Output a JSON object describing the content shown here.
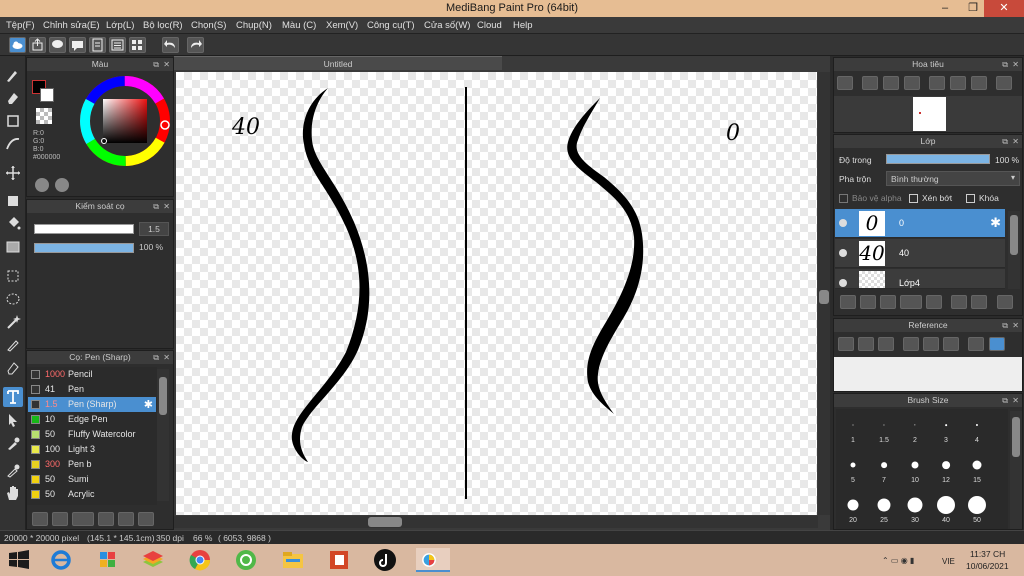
{
  "window": {
    "title": "MediBang Paint Pro (64bit)",
    "minimize": "–",
    "maximize": "❐",
    "close": "✕"
  },
  "menu": [
    "Tệp(F)",
    "Chỉnh sửa(E)",
    "Lớp(L)",
    "Bộ lọc(R)",
    "Chọn(S)",
    "Chụp(N)",
    "Màu (C)",
    "Xem(V)",
    "Công cụ(T)",
    "Cửa số(W)",
    "Cloud",
    "Help"
  ],
  "color_panel": {
    "title": "Màu",
    "r": "R:0",
    "g": "G:0",
    "b": "B:0",
    "hex": "#000000"
  },
  "brush_control": {
    "title": "Kiểm soát cọ",
    "size": "1.5",
    "opacity": "100 %"
  },
  "brush_list": {
    "title": "Cọ: Pen (Sharp)",
    "items": [
      {
        "size": "1000",
        "name": "Pencil",
        "color": "#333333",
        "size_color": "#ff6a6a"
      },
      {
        "size": "41",
        "name": "Pen",
        "color": "#333333",
        "size_color": "#e6e6e6"
      },
      {
        "size": "1.5",
        "name": "Pen (Sharp)",
        "color": "#333333",
        "size_color": "#ff8a8a"
      },
      {
        "size": "10",
        "name": "Edge Pen",
        "color": "#18b818",
        "size_color": "#e6e6e6"
      },
      {
        "size": "50",
        "name": "Fluffy Watercolor",
        "color": "#b8e070",
        "size_color": "#e6e6e6"
      },
      {
        "size": "100",
        "name": "Light 3",
        "color": "#e8e84a",
        "size_color": "#e6e6e6"
      },
      {
        "size": "300",
        "name": "Pen b",
        "color": "#e8d020",
        "size_color": "#ff6a6a"
      },
      {
        "size": "50",
        "name": "Sumi",
        "color": "#f0d010",
        "size_color": "#e6e6e6"
      },
      {
        "size": "50",
        "name": "Acrylic",
        "color": "#f0d010",
        "size_color": "#e6e6e6"
      }
    ]
  },
  "canvas": {
    "tab": "Untitled",
    "label_left": "40",
    "label_right": "0"
  },
  "navigator": {
    "title": "Hoa tiêu"
  },
  "layers": {
    "title": "Lớp",
    "opacity_label": "Độ trong",
    "opacity_value": "100 %",
    "blend_label": "Pha trộn",
    "blend_value": "Bình thường",
    "protect_alpha": "Bảo vệ alpha",
    "clipping": "Xén bớt",
    "lock": "Khóa",
    "items": [
      {
        "name": "0",
        "thumb": "0",
        "selected": true
      },
      {
        "name": "40",
        "thumb": "40",
        "selected": false
      },
      {
        "name": "Lớp4",
        "thumb": "",
        "selected": false
      }
    ]
  },
  "reference": {
    "title": "Reference"
  },
  "brush_size": {
    "title": "Brush Size",
    "sizes": [
      "1",
      "1.5",
      "2",
      "3",
      "4",
      "5",
      "7",
      "10",
      "12",
      "15",
      "20",
      "25",
      "30",
      "40",
      "50"
    ]
  },
  "status": {
    "size": "20000 * 20000 pixel",
    "cm": "(145.1 * 145.1cm)",
    "dpi": "350 dpi",
    "zoom": "66 %",
    "coords": "( 6053, 9868 )"
  },
  "taskbar": {
    "lang": "VIE",
    "time": "11:37 CH",
    "date": "10/06/2021"
  }
}
